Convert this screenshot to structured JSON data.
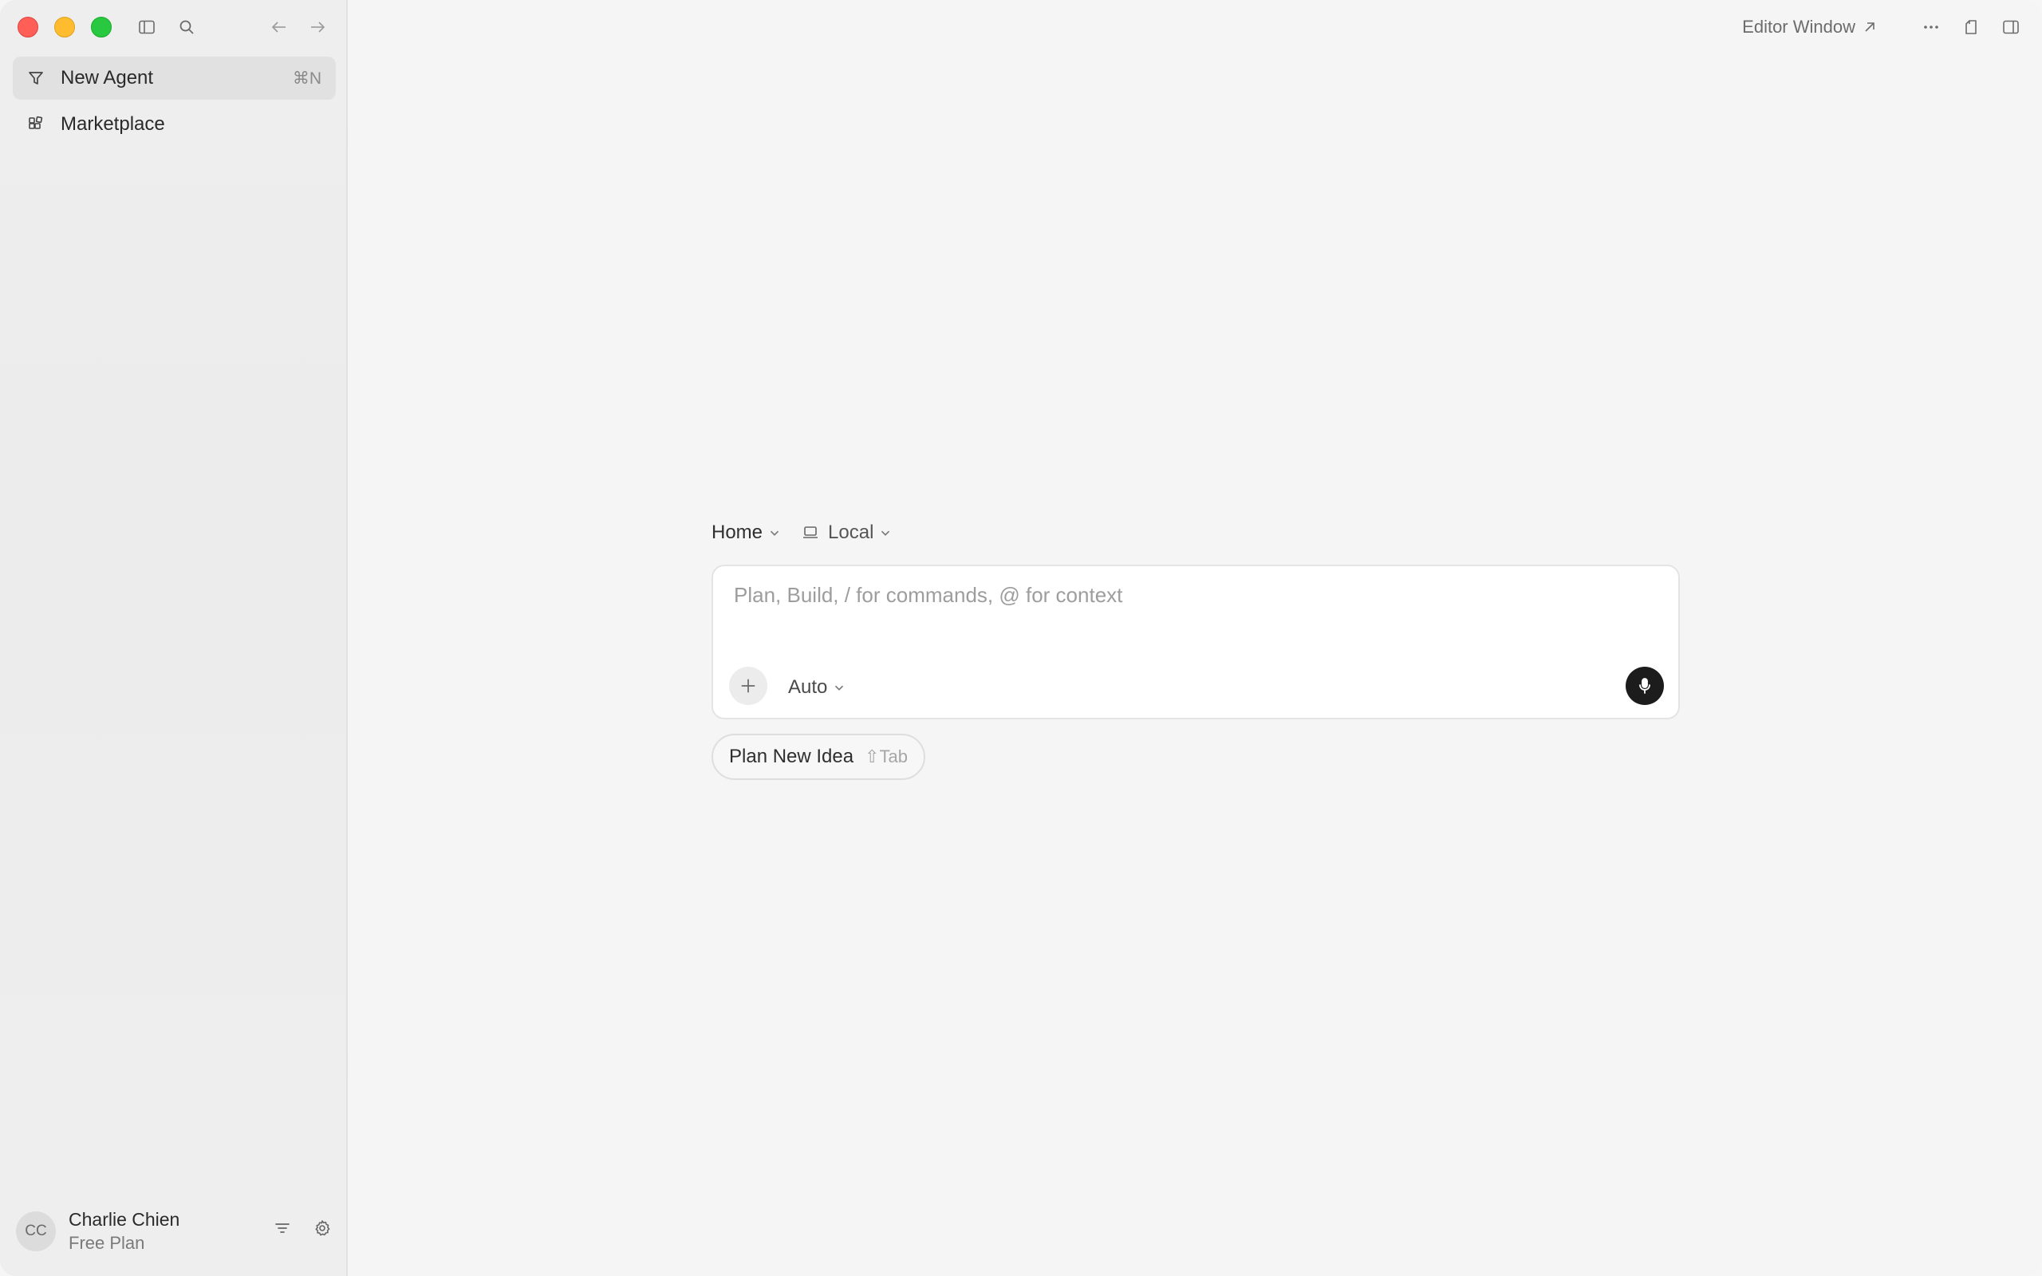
{
  "sidebar": {
    "items": [
      {
        "label": "New Agent",
        "shortcut": "⌘N",
        "icon": "new-agent-icon"
      },
      {
        "label": "Marketplace",
        "icon": "marketplace-icon"
      }
    ],
    "user": {
      "initials": "CC",
      "name": "Charlie Chien",
      "plan": "Free Plan"
    }
  },
  "topbar": {
    "editor_window_label": "Editor Window"
  },
  "composer": {
    "context": {
      "workspace": "Home",
      "environment": "Local"
    },
    "placeholder": "Plan, Build, / for commands, @ for context",
    "model": "Auto"
  },
  "suggestion": {
    "label": "Plan New Idea",
    "shortcut": "⇧Tab"
  },
  "colors": {
    "close": "#ff5f57",
    "minimize": "#febc2e",
    "maximize": "#28c840",
    "mic_button": "#1c1c1c"
  }
}
